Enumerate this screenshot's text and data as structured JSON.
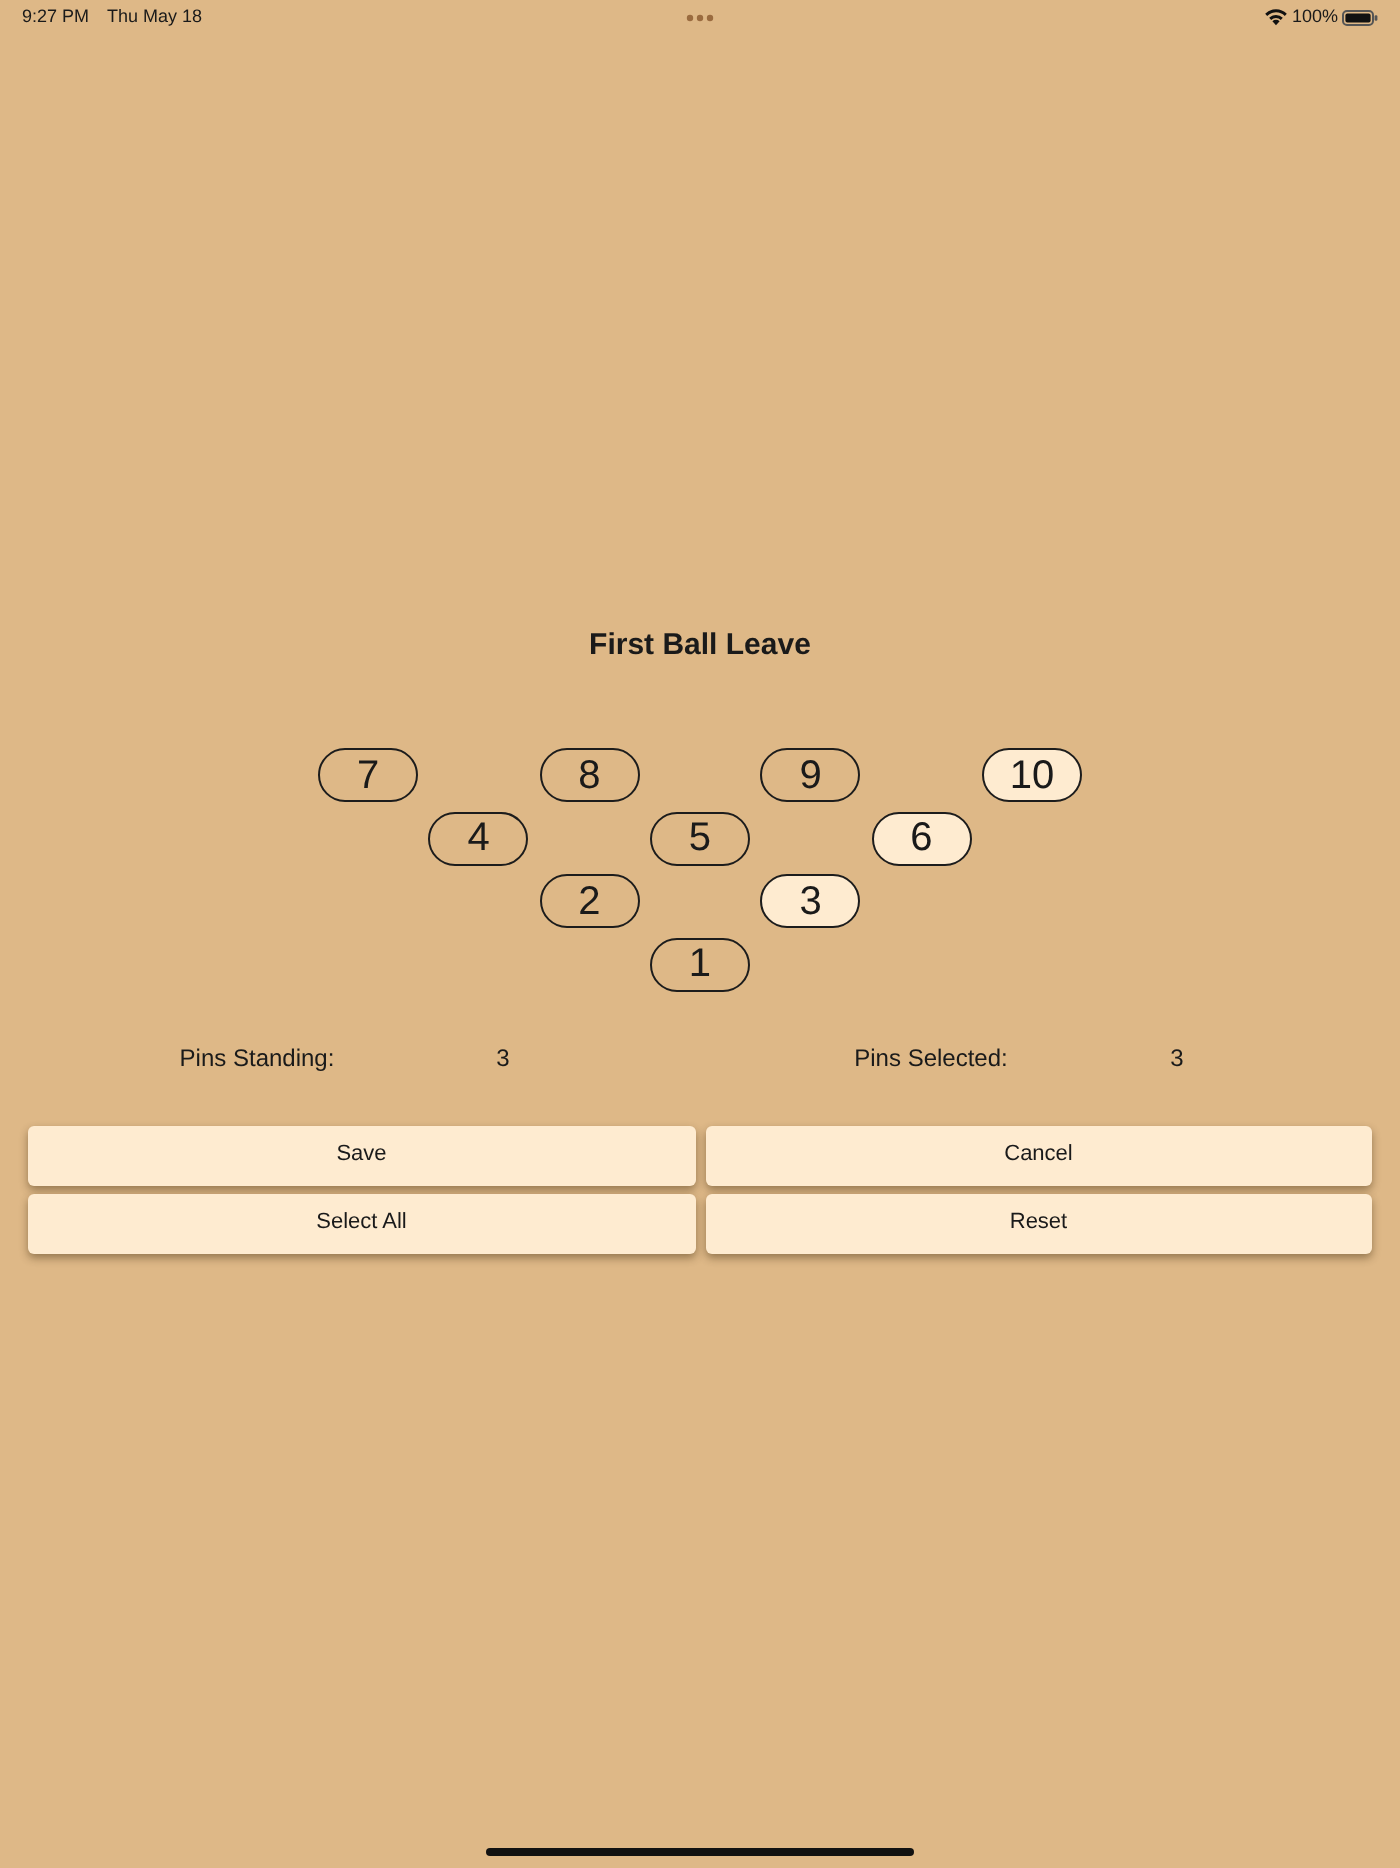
{
  "status_bar": {
    "time": "9:27 PM",
    "date": "Thu May 18",
    "battery": "100%"
  },
  "title": "First Ball Leave",
  "pin_rows": [
    [
      {
        "label": "7",
        "selected": false
      },
      {
        "label": "8",
        "selected": false
      },
      {
        "label": "9",
        "selected": false
      },
      {
        "label": "10",
        "selected": true
      }
    ],
    [
      {
        "label": "4",
        "selected": false
      },
      {
        "label": "5",
        "selected": false
      },
      {
        "label": "6",
        "selected": true
      }
    ],
    [
      {
        "label": "2",
        "selected": false
      },
      {
        "label": "3",
        "selected": true
      }
    ],
    [
      {
        "label": "1",
        "selected": false
      }
    ]
  ],
  "stats": [
    {
      "label": "Pins Standing:",
      "value": "3"
    },
    {
      "label": "Pins Selected:",
      "value": "3"
    }
  ],
  "buttons": [
    "Save",
    "Cancel",
    "Select All",
    "Reset"
  ]
}
